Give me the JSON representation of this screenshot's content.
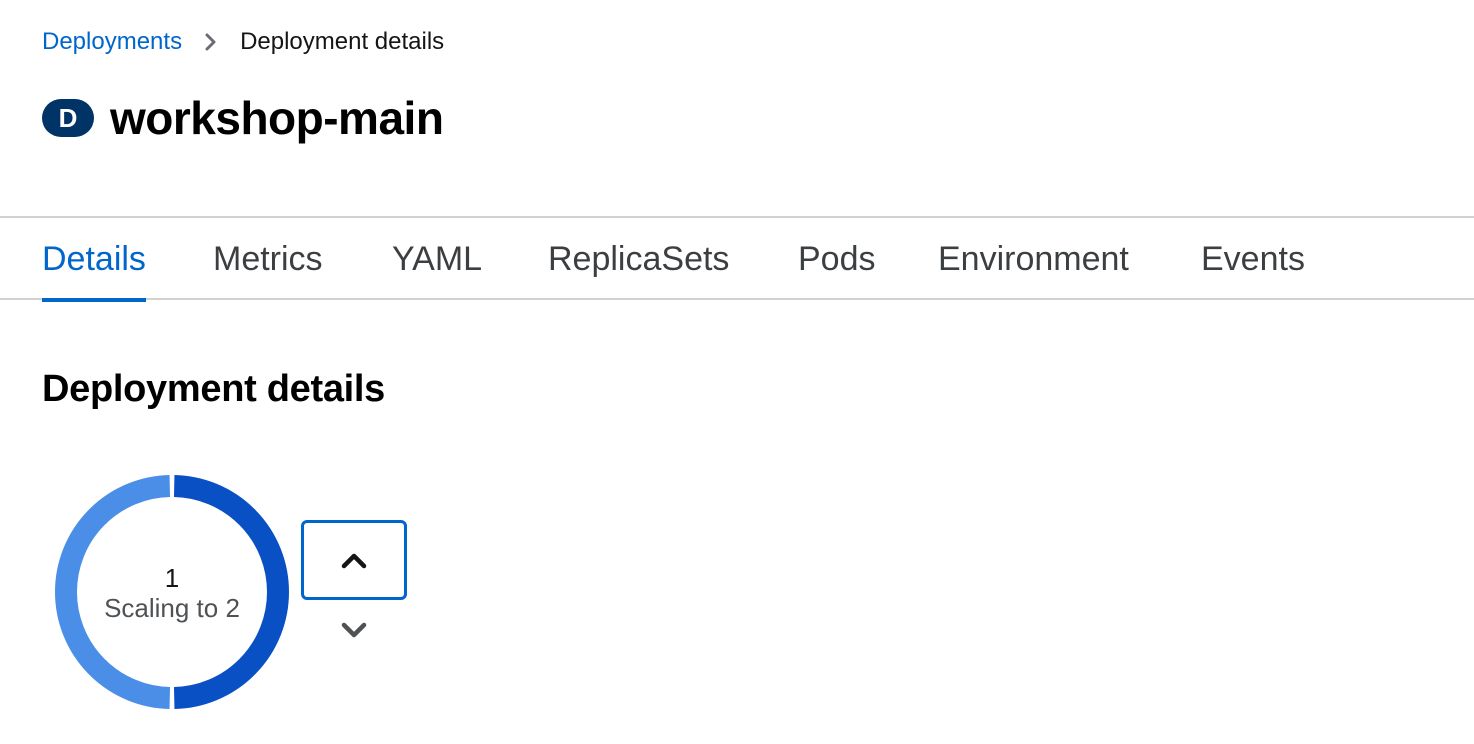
{
  "breadcrumb": {
    "parent_label": "Deployments",
    "separator_icon": "chevron-right-icon",
    "current_label": "Deployment details"
  },
  "header": {
    "badge_letter": "D",
    "badge_color": "#003366",
    "title": "workshop-main"
  },
  "tabs": [
    {
      "label": "Details",
      "active": true
    },
    {
      "label": "Metrics",
      "active": false
    },
    {
      "label": "YAML",
      "active": false
    },
    {
      "label": "ReplicaSets",
      "active": false
    },
    {
      "label": "Pods",
      "active": false
    },
    {
      "label": "Environment",
      "active": false
    },
    {
      "label": "Events",
      "active": false
    }
  ],
  "section": {
    "title": "Deployment details"
  },
  "pod_ring": {
    "count": "1",
    "status": "Scaling to 2",
    "segments": [
      {
        "color": "#0a50c5",
        "fraction": 0.5
      },
      {
        "color": "#4a8ee8",
        "fraction": 0.5
      }
    ]
  },
  "scale_controls": {
    "up_icon": "chevron-up-icon",
    "down_icon": "chevron-down-icon"
  },
  "colors": {
    "accent": "#0066cc",
    "text": "#151515",
    "border": "#d2d2d2"
  }
}
